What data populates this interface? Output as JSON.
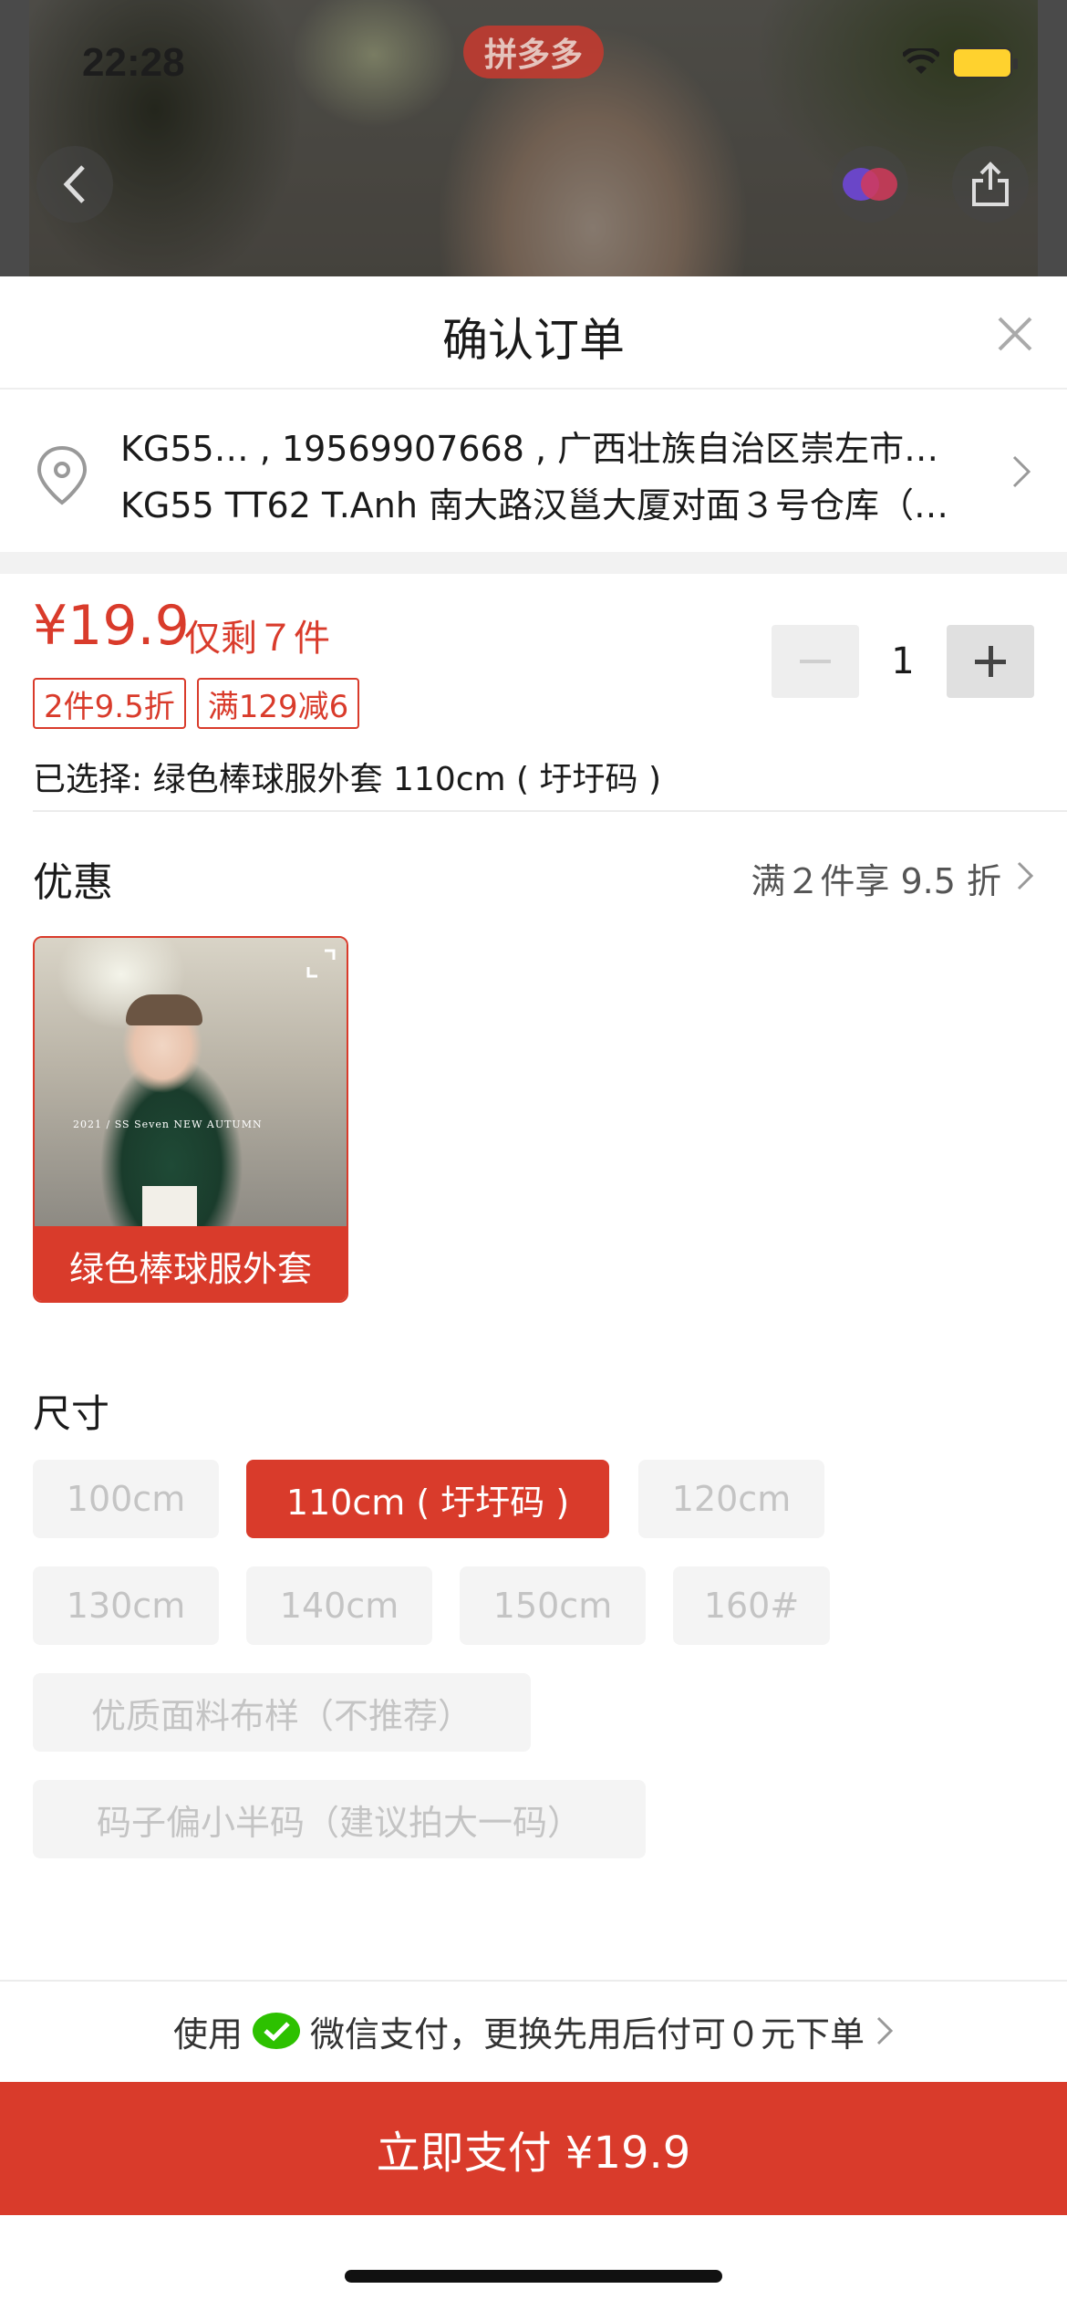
{
  "status_bar": {
    "time": "22:28",
    "brand": "拼多多"
  },
  "header": {
    "title": "确认订单"
  },
  "address": {
    "line1": "KG55… , 19569907668 , 广西壮族自治区崇左市…",
    "line2": "KG55 TT62 T.Anh 南大路汉邕大厦对面３号仓库（…"
  },
  "product": {
    "price": "¥19.9",
    "stock": "仅剩７件",
    "tags": [
      "2件9.5折",
      "满129减6"
    ],
    "selected": "已选择: 绿色棒球服外套 110cm ( 圩圩码 )",
    "quantity": "1",
    "minus": "−",
    "plus": "+"
  },
  "promo": {
    "label": "优惠",
    "value": "满２件享 9.5 折"
  },
  "variant": {
    "label": "绿色棒球服外套",
    "photo_caption": "2021 / SS Seven NEW AUTUMN"
  },
  "size": {
    "label": "尺寸",
    "options": [
      "100cm",
      "110cm ( 圩圩码 )",
      "120cm",
      "130cm",
      "140cm",
      "150cm",
      "160#",
      "优质面料布样（不推荐）",
      "码子偏小半码（建议拍大一码）"
    ],
    "selected_index": 1
  },
  "payment": {
    "prefix": "使用",
    "method": "微信支付",
    "suffix": "，更换先用后付可０元下单",
    "button": "立即支付 ¥19.9"
  },
  "colors": {
    "accent": "#d93b2b",
    "wechat": "#2dc100"
  }
}
